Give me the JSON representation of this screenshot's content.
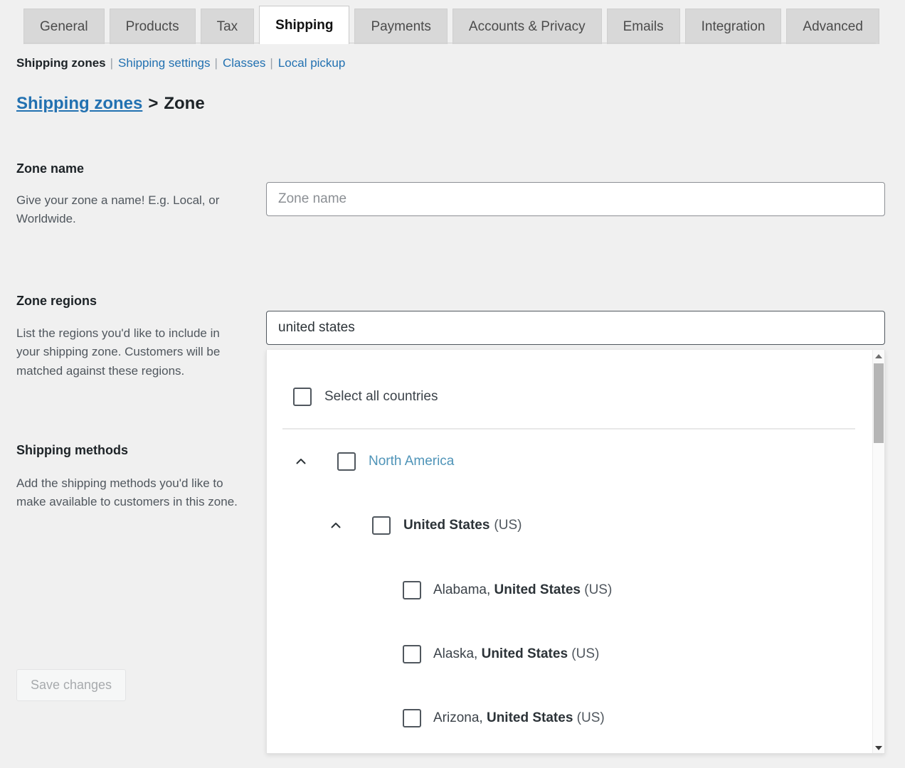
{
  "tabs": [
    {
      "label": "General",
      "active": false
    },
    {
      "label": "Products",
      "active": false
    },
    {
      "label": "Tax",
      "active": false
    },
    {
      "label": "Shipping",
      "active": true
    },
    {
      "label": "Payments",
      "active": false
    },
    {
      "label": "Accounts & Privacy",
      "active": false
    },
    {
      "label": "Emails",
      "active": false
    },
    {
      "label": "Integration",
      "active": false
    },
    {
      "label": "Advanced",
      "active": false
    }
  ],
  "subnav": {
    "current": "Shipping zones",
    "links": [
      "Shipping settings",
      "Classes",
      "Local pickup"
    ],
    "separator": "|"
  },
  "breadcrumb": {
    "link": "Shipping zones",
    "separator": ">",
    "current": "Zone"
  },
  "sections": {
    "zone_name": {
      "title": "Zone name",
      "description": "Give your zone a name! E.g. Local, or Worldwide.",
      "input_placeholder": "Zone name",
      "input_value": ""
    },
    "zone_regions": {
      "title": "Zone regions",
      "description": "List the regions you'd like to include in your shipping zone. Customers will be matched against these regions.",
      "input_placeholder": "",
      "input_value": "united states"
    },
    "shipping_methods": {
      "title": "Shipping methods",
      "description": "Add the shipping methods you'd like to make available to customers in this zone."
    }
  },
  "dropdown": {
    "select_all_label": "Select all countries",
    "select_all_checked": false,
    "items": [
      {
        "id": "north-america",
        "label": "North America",
        "style": "link",
        "checked": false,
        "expanded": true,
        "chevron": "chevron-up-icon"
      },
      {
        "id": "united-states",
        "name": "United States",
        "code": "(US)",
        "style": "country",
        "checked": false,
        "expanded": true,
        "chevron": "chevron-up-icon"
      },
      {
        "id": "alabama",
        "state": "Alabama, ",
        "name": "United States",
        "code": " (US)",
        "style": "state",
        "checked": false
      },
      {
        "id": "alaska",
        "state": "Alaska, ",
        "name": "United States",
        "code": " (US)",
        "style": "state",
        "checked": false
      },
      {
        "id": "arizona",
        "state": "Arizona, ",
        "name": "United States",
        "code": " (US)",
        "style": "state",
        "checked": false
      }
    ],
    "scrollbar": {
      "up_icon": "scroll-up-arrow-icon",
      "down_icon": "scroll-down-arrow-icon"
    }
  },
  "footer": {
    "save_label": "Save changes",
    "save_disabled": true
  },
  "colors": {
    "page_bg": "#f0f0f0",
    "link": "#2271b1",
    "region_link": "#4f94b8",
    "text": "#1d2327",
    "muted": "#50575e",
    "tab_inactive_bg": "#d8d8d8",
    "tab_active_bg": "#ffffff"
  }
}
